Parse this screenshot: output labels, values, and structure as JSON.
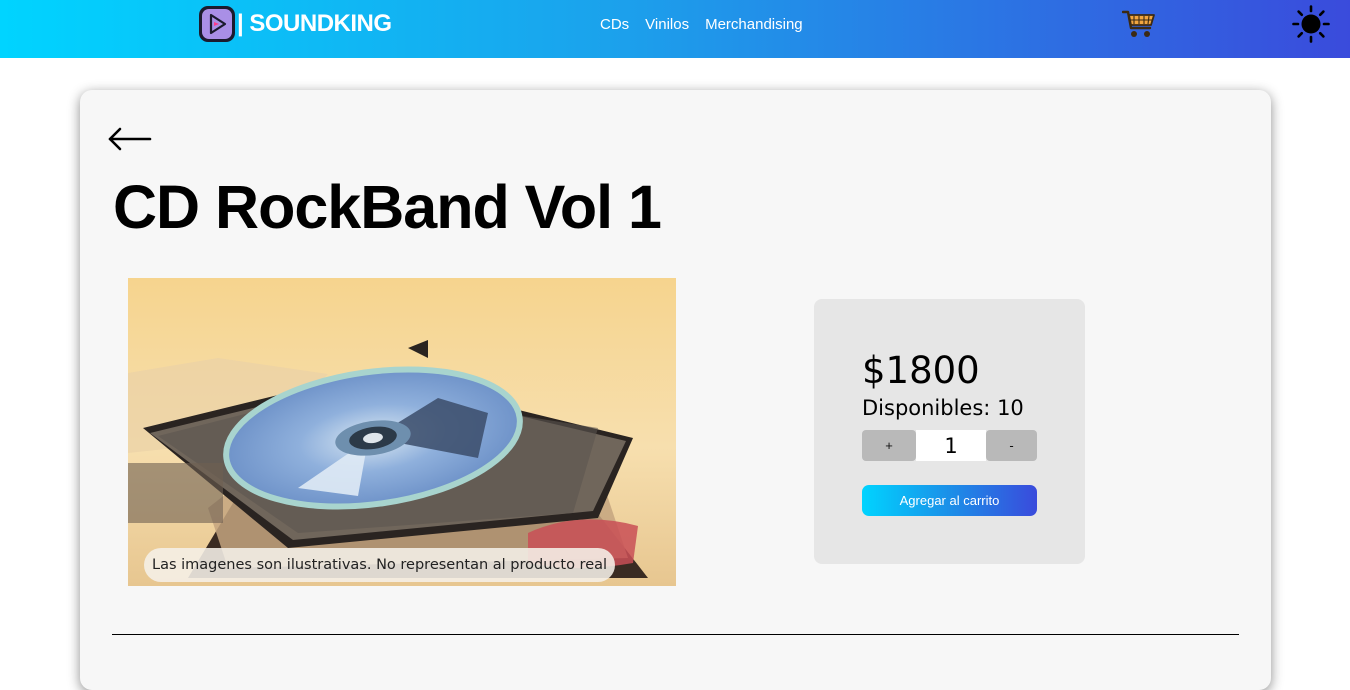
{
  "brand": {
    "name": "| SOUNDKING"
  },
  "nav": {
    "links": [
      "CDs",
      "Vinilos",
      "Merchandising"
    ]
  },
  "header": {
    "cart_icon": "shopping-cart-icon",
    "theme_icon": "sun-icon"
  },
  "product": {
    "title": "CD RockBand Vol 1",
    "image_caption": "Las imagenes son ilustrativas. No representan al producto real",
    "price": "$1800",
    "stock_label": "Disponibles:",
    "stock_value": "10",
    "quantity": "1",
    "increment_label": "+",
    "decrement_label": "-",
    "add_to_cart_label": "Agregar al carrito"
  },
  "colors": {
    "accent_start": "#00d4ff",
    "accent_end": "#3a4bdc",
    "card_bg": "#f7f7f7",
    "buy_box_bg": "#e6e6e6"
  }
}
